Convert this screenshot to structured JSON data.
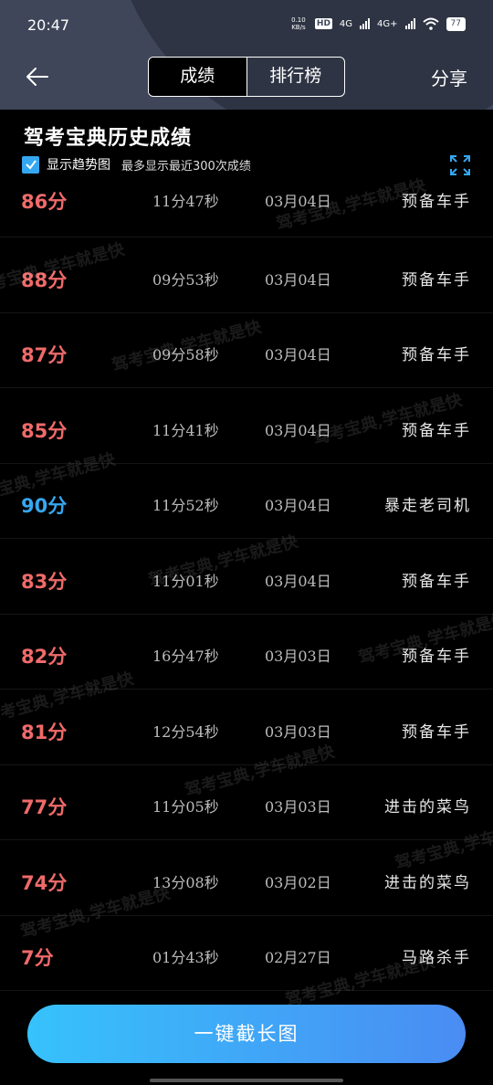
{
  "status_bar": {
    "time": "20:47",
    "net_speed": "0.10 KB/s",
    "hd": "HD",
    "sim1": "4G",
    "sim2": "4G+",
    "battery": "77"
  },
  "header": {
    "tabs": [
      "成绩",
      "排行榜"
    ],
    "share_label": "分享"
  },
  "title": "驾考宝典历史成绩",
  "trend": {
    "label": "显示趋势图",
    "note": "最多显示最近300次成绩",
    "checked": true
  },
  "rows": [
    {
      "score": "86分",
      "duration": "11分47秒",
      "date": "03月04日",
      "rank": "预备车手"
    },
    {
      "score": "88分",
      "duration": "09分53秒",
      "date": "03月04日",
      "rank": "预备车手"
    },
    {
      "score": "87分",
      "duration": "09分58秒",
      "date": "03月04日",
      "rank": "预备车手"
    },
    {
      "score": "85分",
      "duration": "11分41秒",
      "date": "03月04日",
      "rank": "预备车手"
    },
    {
      "score": "90分",
      "duration": "11分52秒",
      "date": "03月04日",
      "rank": "暴走老司机"
    },
    {
      "score": "83分",
      "duration": "11分01秒",
      "date": "03月04日",
      "rank": "预备车手"
    },
    {
      "score": "82分",
      "duration": "16分47秒",
      "date": "03月03日",
      "rank": "预备车手"
    },
    {
      "score": "81分",
      "duration": "12分54秒",
      "date": "03月03日",
      "rank": "预备车手"
    },
    {
      "score": "77分",
      "duration": "11分05秒",
      "date": "03月03日",
      "rank": "进击的菜鸟"
    },
    {
      "score": "74分",
      "duration": "13分08秒",
      "date": "03月02日",
      "rank": "进击的菜鸟"
    },
    {
      "score": "7分",
      "duration": "01分43秒",
      "date": "02月27日",
      "rank": "马路杀手"
    }
  ],
  "watermark": "驾考宝典,学车就是快",
  "cta_label": "一键截长图",
  "colors": {
    "fail": "#f06a6a",
    "pass": "#35a7f0",
    "cta_start": "#36c2fb",
    "cta_end": "#4a8cf3"
  }
}
